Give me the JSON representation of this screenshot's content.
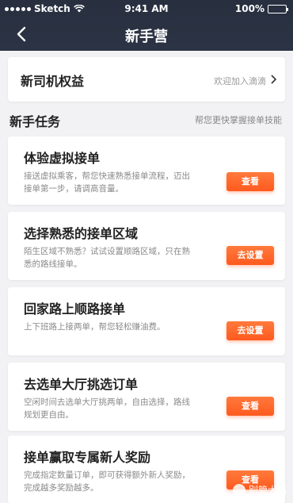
{
  "status": {
    "carrier": "Sketch",
    "time": "9:41 AM",
    "battery": "100%",
    "battery_level": 1.0
  },
  "header": {
    "title": "新手营"
  },
  "benefit": {
    "title": "新司机权益",
    "subtitle": "欢迎加入滴滴"
  },
  "section": {
    "title": "新手任务",
    "subtitle": "帮您更快掌握接单技能"
  },
  "tasks": [
    {
      "title": "体验虚拟接单",
      "desc": "接送虚拟乘客，帮您快速熟悉接单流程，迈出接单第一步，请调高音量。",
      "button": "查看"
    },
    {
      "title": "选择熟悉的接单区域",
      "desc": "陌生区域不熟悉？试试设置顺路区域，只在熟悉的路线接单。",
      "button": "去设置"
    },
    {
      "title": "回家路上顺路接单",
      "desc": "上下班路上接两单，帮您轻松赚油费。",
      "button": "去设置"
    },
    {
      "title": "去选单大厅挑选订单",
      "desc": "空闲时间去选单大厅挑两单，自由选择，路线规划更自由。",
      "button": "查看"
    },
    {
      "title": "接单赢取专属新人奖励",
      "desc": "完成指定数量订单，即可获得额外新人奖励，完成越多奖励越多。",
      "button": "查看"
    }
  ],
  "watermark": {
    "text": "别管大嘴"
  },
  "colors": {
    "nav_bg": "#283040",
    "accent": "#ff5a1e",
    "page_bg": "#f2f2f4"
  }
}
